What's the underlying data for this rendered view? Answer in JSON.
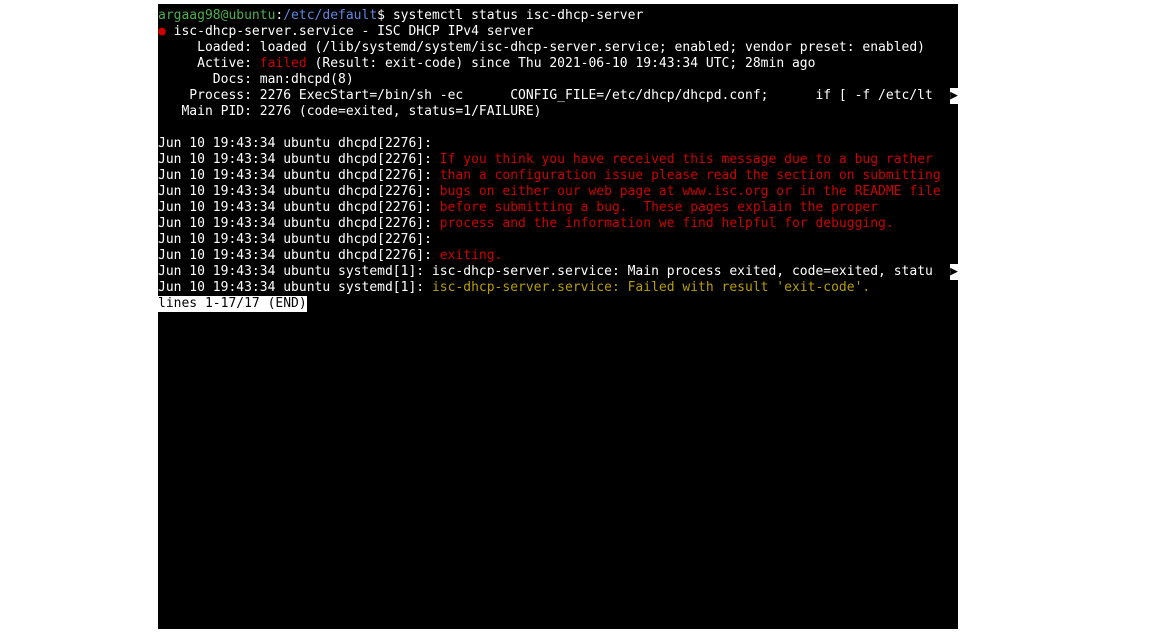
{
  "prompt": {
    "user_host": "argaag98@ubuntu",
    "colon": ":",
    "path": "/etc/default",
    "dollar": "$ ",
    "command": "systemctl status isc-dhcp-server"
  },
  "status": {
    "bullet": "●",
    "service_line": " isc-dhcp-server.service - ISC DHCP IPv4 server",
    "loaded_line": "     Loaded: loaded (/lib/systemd/system/isc-dhcp-server.service; enabled; vendor preset: enabled)",
    "active_prefix": "     Active: ",
    "active_failed": "failed",
    "active_suffix": " (Result: exit-code) since Thu 2021-06-10 19:43:34 UTC; 28min ago",
    "docs_line": "       Docs: man:dhcpd(8)",
    "process_line": "    Process: 2276 ExecStart=/bin/sh -ec      CONFIG_FILE=/etc/dhcp/dhcpd.conf;      if [ -f /etc/lt",
    "process_overflow": "▶",
    "mainpid_line": "   Main PID: 2276 (code=exited, status=1/FAILURE)"
  },
  "logs": {
    "prefix": "Jun 10 19:43:34 ubuntu dhcpd[2276]: ",
    "sys_prefix": "Jun 10 19:43:34 ubuntu systemd[1]: ",
    "msg1": "",
    "msg2": "If you think you have received this message due to a bug rather",
    "msg3": "than a configuration issue please read the section on submitting",
    "msg4": "bugs on either our web page at www.isc.org or in the README file",
    "msg5": "before submitting a bug.  These pages explain the proper",
    "msg6": "process and the information we find helpful for debugging.",
    "msg7": "",
    "msg8": "exiting.",
    "sys1": "isc-dhcp-server.service: Main process exited, code=exited, statu",
    "sys1_overflow": "▶",
    "sys2": "isc-dhcp-server.service: Failed with result 'exit-code'."
  },
  "pager": "lines 1-17/17 (END)"
}
